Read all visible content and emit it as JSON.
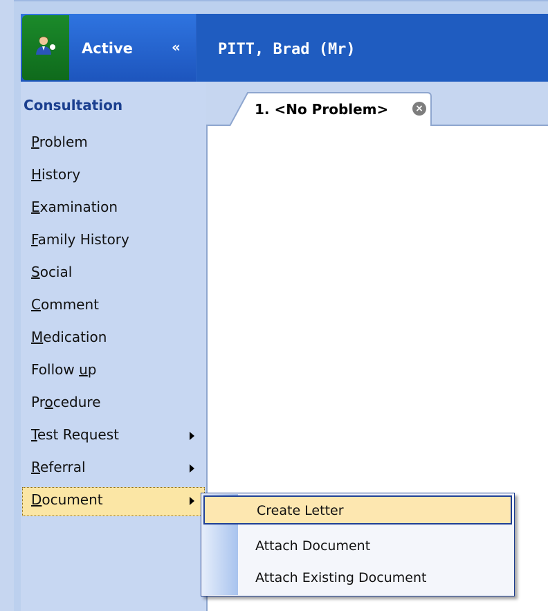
{
  "header": {
    "status_label": "Active",
    "expand_icon": "double-chevron-down-icon",
    "patient_name": "PITT, Brad (Mr)"
  },
  "sidebar": {
    "title": "Consultation",
    "items": [
      {
        "label": "Problem",
        "mnemonic": "P"
      },
      {
        "label": "History",
        "mnemonic": "H"
      },
      {
        "label": "Examination",
        "mnemonic": "E"
      },
      {
        "label": "Family History",
        "mnemonic": "F"
      },
      {
        "label": "Social",
        "mnemonic": "S"
      },
      {
        "label": "Comment",
        "mnemonic": "C"
      },
      {
        "label": "Medication",
        "mnemonic": "M"
      },
      {
        "label": "Follow up",
        "mnemonic": "u"
      },
      {
        "label": "Procedure",
        "mnemonic": "o"
      },
      {
        "label": "Test Request",
        "mnemonic": "T",
        "submenu": true
      },
      {
        "label": "Referral",
        "mnemonic": "R",
        "submenu": true
      },
      {
        "label": "Document",
        "mnemonic": "D",
        "submenu": true,
        "selected": true
      }
    ]
  },
  "tabs": [
    {
      "label": "1. <No Problem>",
      "close_icon": "close-circle-icon"
    }
  ],
  "submenu": {
    "items": [
      {
        "label": "Create Letter",
        "highlighted": true
      },
      {
        "label": "Attach Document"
      },
      {
        "label": "Attach Existing Document"
      }
    ]
  },
  "colors": {
    "header_blue": "#1f5cc0",
    "status_green": "#1b8a2a",
    "sidebar_bg": "#c7d7f2",
    "title_blue": "#1b3f8f",
    "selected_item": "#fbe6a5"
  }
}
